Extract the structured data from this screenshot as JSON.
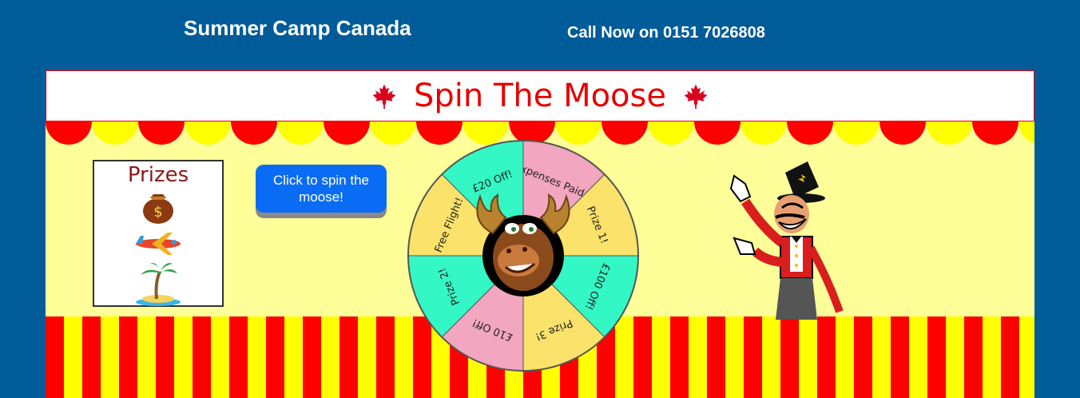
{
  "header": {
    "site_title": "Summer Camp Canada",
    "phone_text": "Call Now on 0151 7026808"
  },
  "banner": {
    "title": "Spin The Moose"
  },
  "prizes": {
    "title": "Prizes",
    "icons": [
      "money-bag-icon",
      "airplane-icon",
      "island-icon"
    ]
  },
  "spin_button": {
    "label": "Click to spin the moose!"
  },
  "wheel": {
    "segments": [
      "All Expenses Paid Trip!",
      "Prize 1!",
      "£100 Off!",
      "Prize 3!",
      "£10 Off!",
      "Prize 2!",
      "Free Flight!",
      "£20 Off!"
    ],
    "colors": [
      "#f3a6bf",
      "#fbe26a",
      "#33f7c4",
      "#fbe26a",
      "#f3a6bf",
      "#33f7c4",
      "#fbe26a",
      "#33f7c4"
    ]
  },
  "colors": {
    "page_bg": "#005b99",
    "banner_text": "#e60000",
    "stage_bg": "#ffff99",
    "stripe_red": "#ff0000",
    "stripe_yellow": "#ffff00",
    "button": "#0a6cf5"
  }
}
